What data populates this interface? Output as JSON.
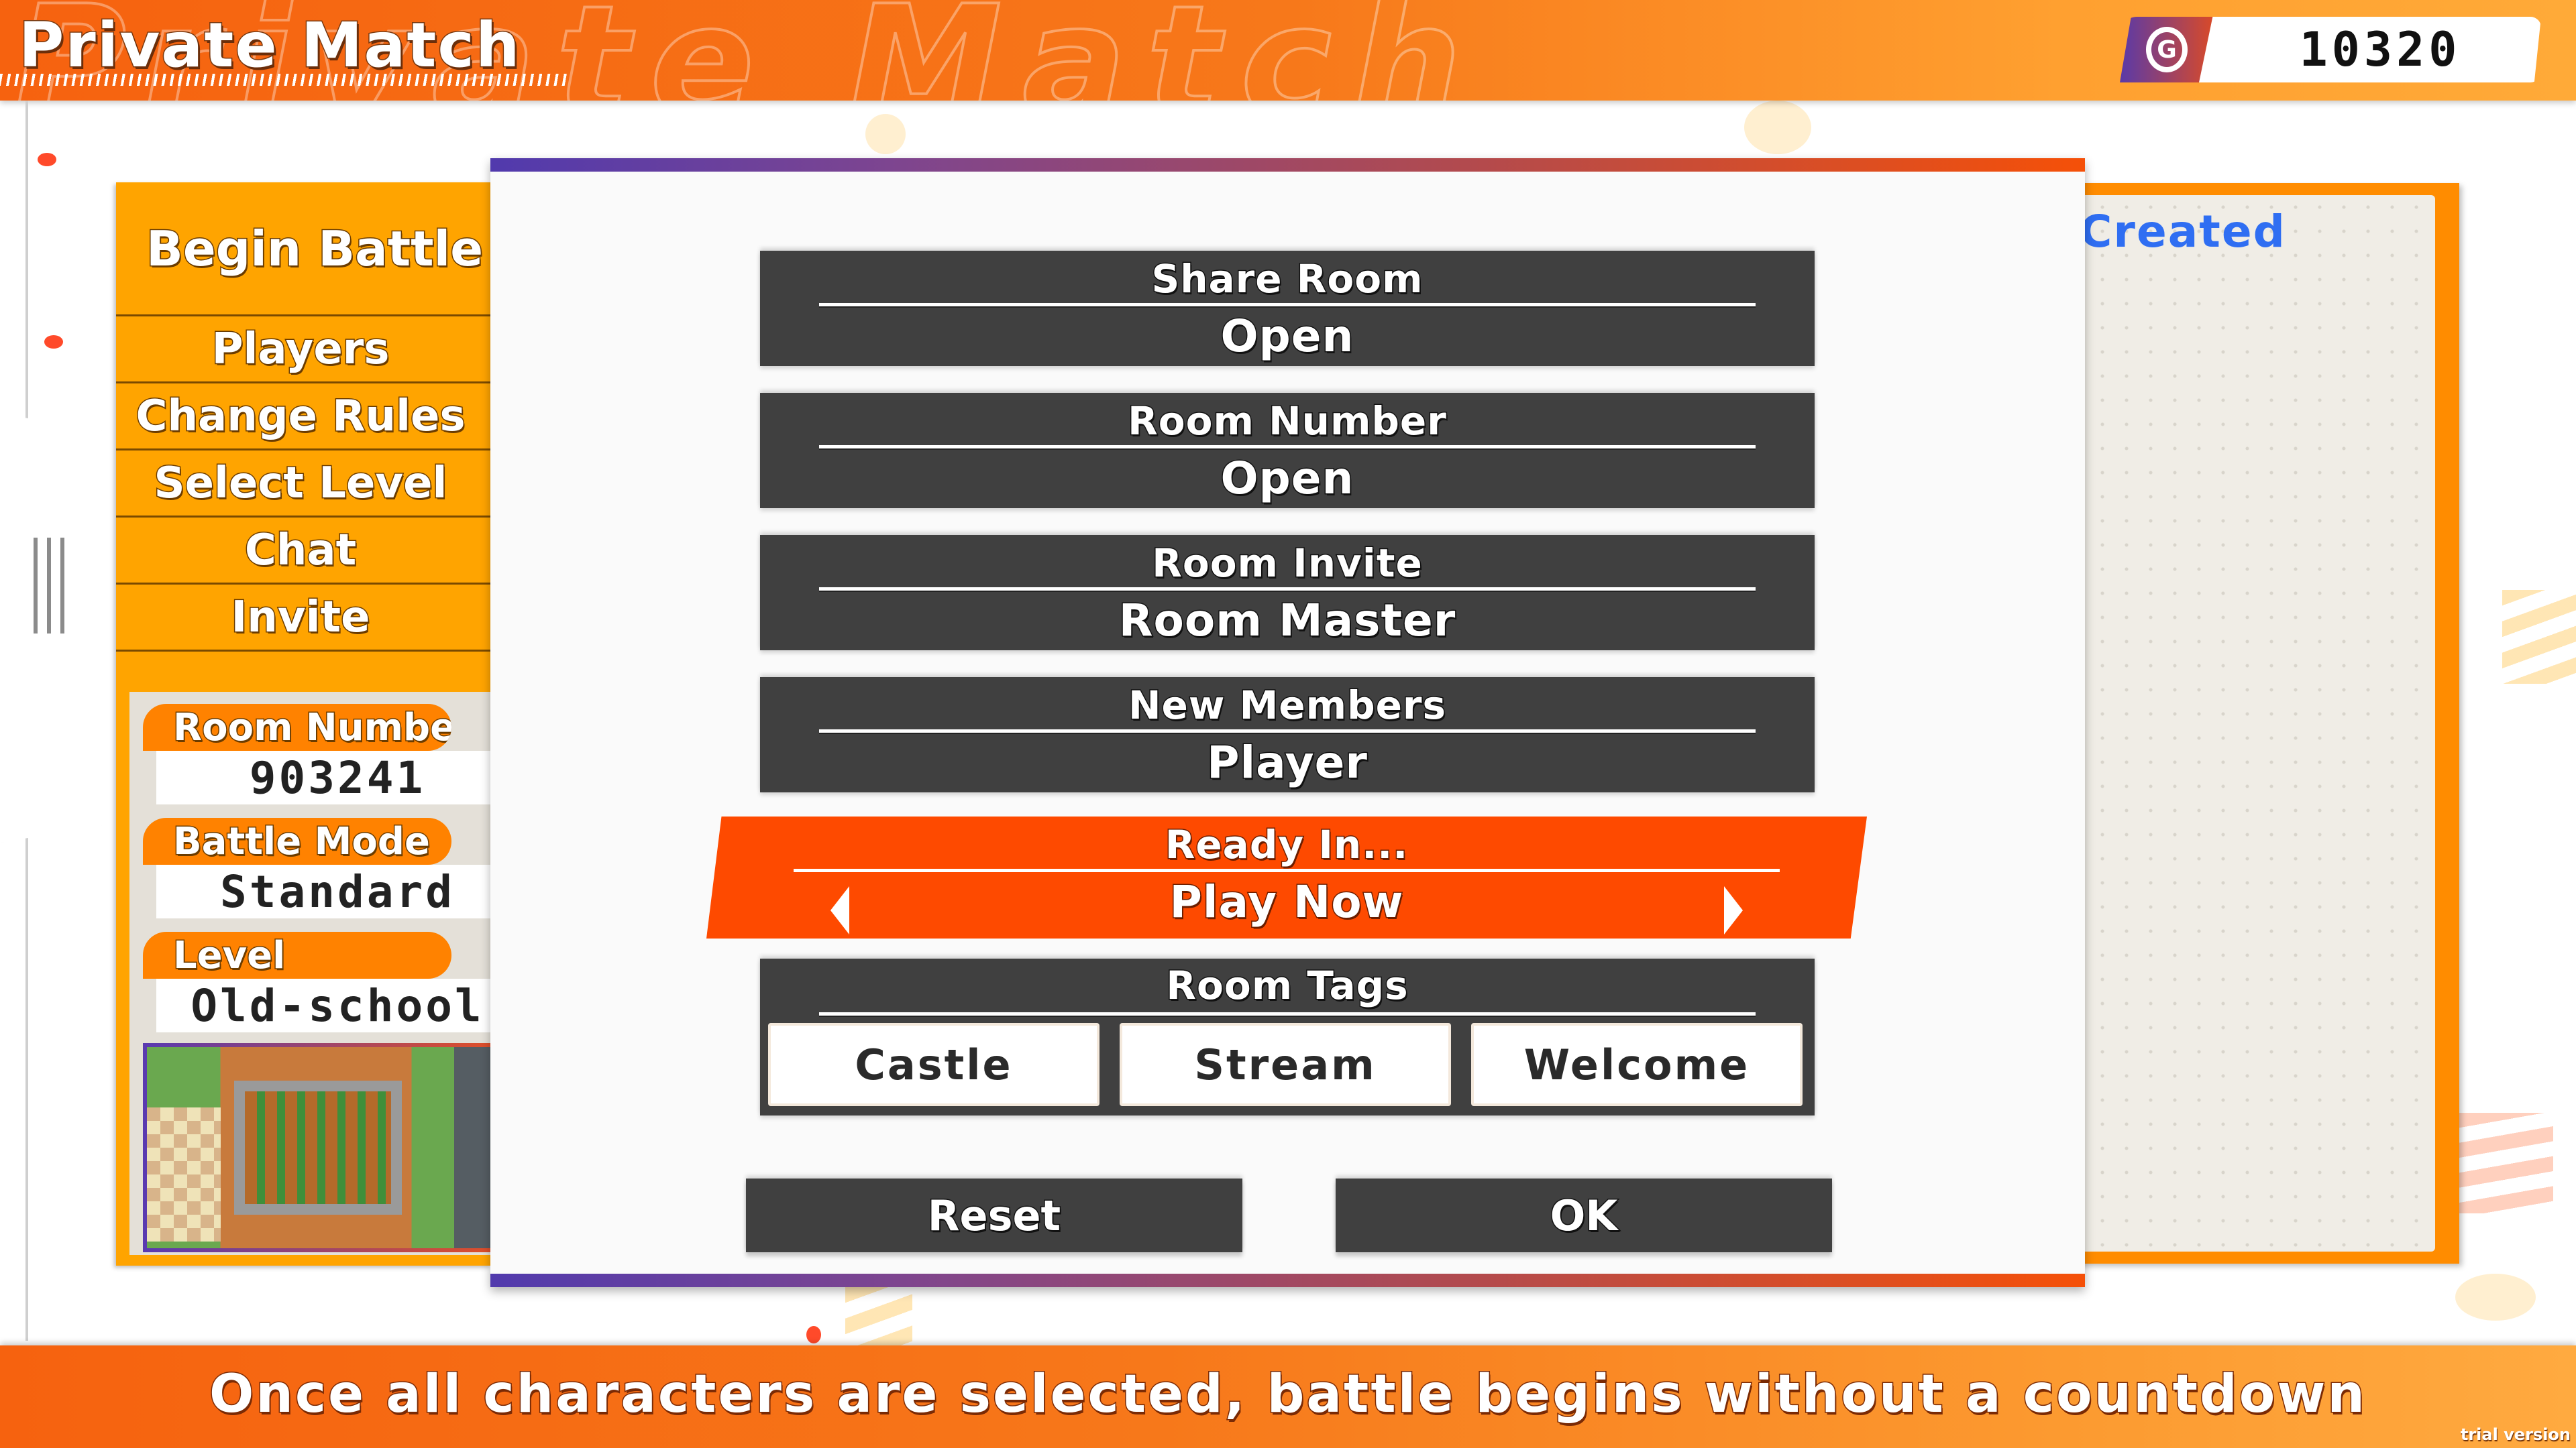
{
  "header": {
    "title": "Private Match",
    "ghost_text": "Private Match",
    "currency_icon": "coin-icon",
    "currency_glyph": "G",
    "currency_amount": "10320"
  },
  "menu": {
    "title": "Begin Battle",
    "items": [
      {
        "label": "Players"
      },
      {
        "label": "Change Rules"
      },
      {
        "label": "Select Level"
      },
      {
        "label": "Chat"
      },
      {
        "label": "Invite"
      }
    ]
  },
  "room_info": {
    "room_number_label": "Room Number",
    "room_number_value": "903241",
    "battle_mode_label": "Battle Mode",
    "battle_mode_value": "Standard",
    "level_label": "Level",
    "level_value": "Old-school",
    "level_thumbnail": "level-preview-image"
  },
  "right_panel": {
    "title": "Created"
  },
  "dialog": {
    "settings": [
      {
        "label": "Share Room",
        "value": "Open"
      },
      {
        "label": "Room Number",
        "value": "Open"
      },
      {
        "label": "Room Invite",
        "value": "Room Master"
      },
      {
        "label": "New Members",
        "value": "Player"
      }
    ],
    "selected_setting": {
      "label": "Ready In...",
      "value": "Play Now",
      "prev_icon": "chevron-left-icon",
      "next_icon": "chevron-right-icon"
    },
    "room_tags": {
      "label": "Room Tags",
      "tags": [
        "Castle",
        "Stream",
        "Welcome"
      ]
    },
    "reset_label": "Reset",
    "ok_label": "OK"
  },
  "footer": {
    "hint": "Once all characters are selected, battle begins without a countdown",
    "watermark": "trial version"
  },
  "colors": {
    "header_orange": "#f6620f",
    "menu_orange": "#ffa400",
    "selected_row": "#fe4a00",
    "row_dark": "#404040",
    "accent_gradient_start": "#513aad",
    "accent_gradient_end": "#f55008",
    "created_blue": "#2f6ef2"
  }
}
